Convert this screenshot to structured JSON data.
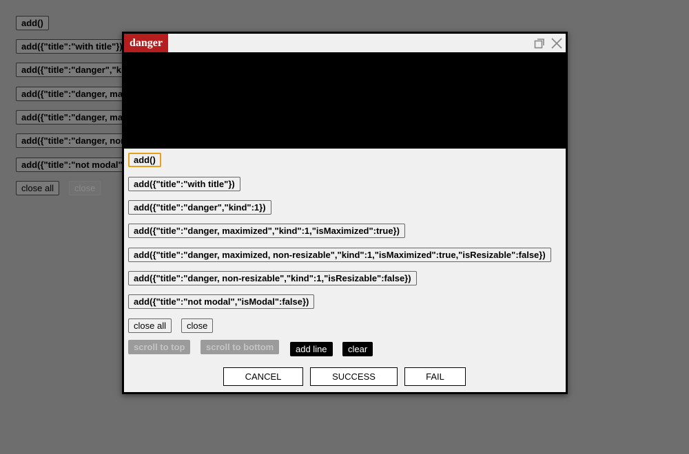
{
  "background": {
    "buttons": [
      {
        "label": "add()"
      },
      {
        "label": "add({\"title\":\"with title\"})"
      },
      {
        "label": "add({\"title\":\"danger\",\"kind\":1})"
      },
      {
        "label": "add({\"title\":\"danger, maximized\",\"kind\":1,\"isMaximized\":true})"
      },
      {
        "label": "add({\"title\":\"danger, maximized, non-resizable\",\"kind\":1,\"isMaximized\":true,\"isResizable\":false})"
      },
      {
        "label": "add({\"title\":\"danger, non-resizable\",\"kind\":1,\"isResizable\":false})"
      },
      {
        "label": "add({\"title\":\"not modal\",\"isModal\":false})"
      }
    ],
    "close_all": "close all",
    "close": "close"
  },
  "modal": {
    "title": "danger",
    "kind_color": "#b41e1e",
    "icons": {
      "maximize": "maximize-icon",
      "close": "close-icon"
    },
    "buttons": [
      {
        "label": "add()"
      },
      {
        "label": "add({\"title\":\"with title\"})"
      },
      {
        "label": "add({\"title\":\"danger\",\"kind\":1})"
      },
      {
        "label": "add({\"title\":\"danger, maximized\",\"kind\":1,\"isMaximized\":true})"
      },
      {
        "label": "add({\"title\":\"danger, maximized, non-resizable\",\"kind\":1,\"isMaximized\":true,\"isResizable\":false})"
      },
      {
        "label": "add({\"title\":\"danger, non-resizable\",\"kind\":1,\"isResizable\":false})"
      },
      {
        "label": "add({\"title\":\"not modal\",\"isModal\":false})"
      }
    ],
    "close_all": "close all",
    "close": "close",
    "scroll_to_top": "scroll to top",
    "scroll_to_bottom": "scroll to bottom",
    "add_line": "add line",
    "clear": "clear",
    "footer": {
      "cancel": "CANCEL",
      "success": "SUCCESS",
      "fail": "FAIL"
    }
  }
}
